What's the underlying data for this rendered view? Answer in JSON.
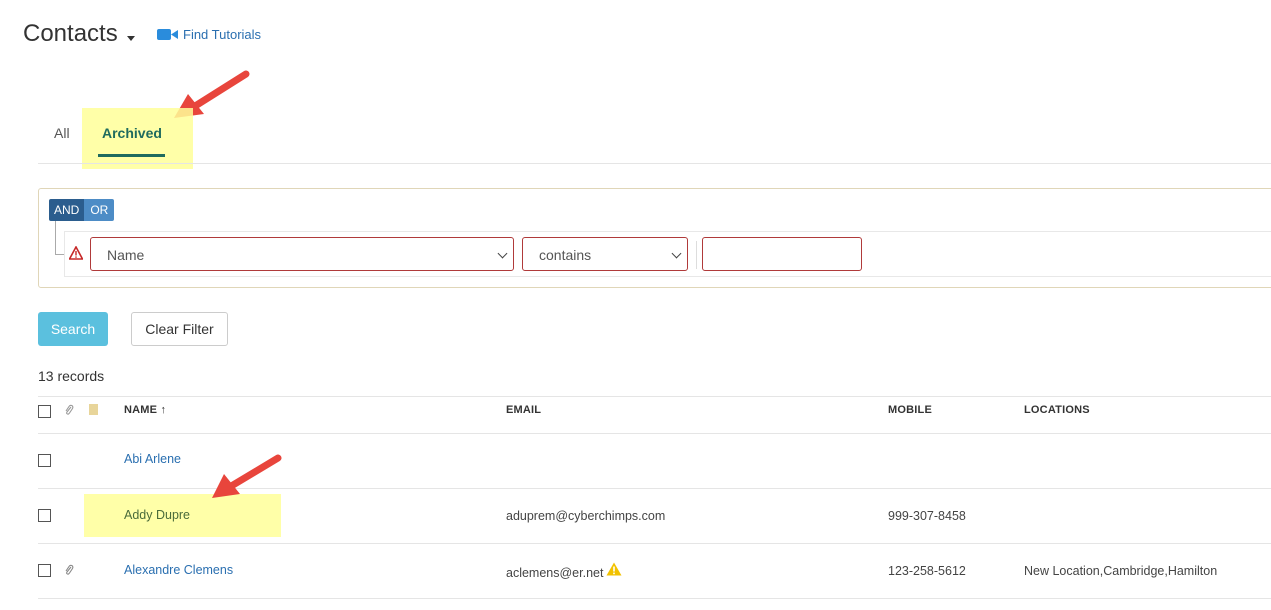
{
  "header": {
    "title": "Contacts",
    "tutorials_label": "Find Tutorials"
  },
  "tabs": [
    {
      "label": "All",
      "active": false
    },
    {
      "label": "Archived",
      "active": true
    }
  ],
  "filter": {
    "and_label": "AND",
    "or_label": "OR",
    "field_value": "Name",
    "operator_value": "contains",
    "value": ""
  },
  "actions": {
    "search_label": "Search",
    "clear_label": "Clear Filter"
  },
  "records_count": "13 records",
  "table": {
    "columns": {
      "name": "NAME ↑",
      "email": "EMAIL",
      "mobile": "MOBILE",
      "locations": "LOCATIONS"
    },
    "rows": [
      {
        "name": "Abi Arlene",
        "email": "",
        "mobile": "",
        "locations": "",
        "has_attachment": false
      },
      {
        "name": "Addy Dupre",
        "email": "aduprem@cyberchimps.com",
        "mobile": "999-307-8458",
        "locations": "",
        "has_attachment": false
      },
      {
        "name": "Alexandre Clemens",
        "email": "aclemens@er.net",
        "mobile": "123-258-5612",
        "locations": "New Location,Cambridge,Hamilton",
        "has_attachment": true
      }
    ]
  },
  "colors": {
    "accent_tab": "#1f6b5e",
    "link": "#2a6fb0",
    "search_button": "#5bc0de",
    "highlight": "#ffff99",
    "annotation_arrow": "#e8453c",
    "error_border": "#b03a3a"
  }
}
